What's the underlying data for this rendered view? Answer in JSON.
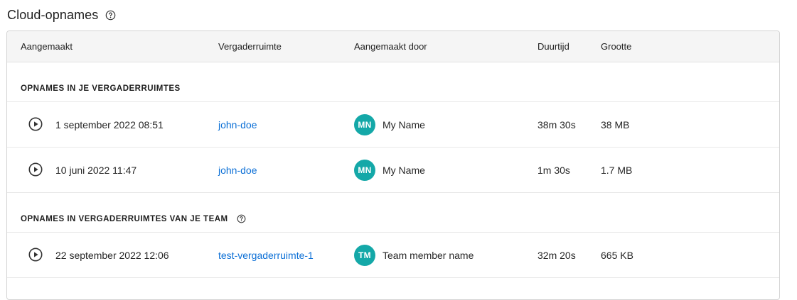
{
  "header": {
    "title": "Cloud-opnames",
    "help_icon": "question-circle-icon"
  },
  "columns": {
    "created": "Aangemaakt",
    "room": "Vergaderruimte",
    "created_by": "Aangemaakt door",
    "duration": "Duurtijd",
    "size": "Grootte"
  },
  "sections": [
    {
      "label": "OPNAMES IN JE VERGADERRUIMTES",
      "rows": [
        {
          "date": "1 september 2022 08:51",
          "room": "john-doe",
          "initials": "MN",
          "name": "My Name",
          "duration": "38m 30s",
          "size": "38 MB"
        },
        {
          "date": "10 juni 2022 11:47",
          "room": "john-doe",
          "initials": "MN",
          "name": "My Name",
          "duration": "1m 30s",
          "size": "1.7 MB"
        }
      ]
    },
    {
      "label": "OPNAMES IN VERGADERRUIMTES VAN JE TEAM",
      "rows": [
        {
          "date": "22 september 2022 12:06",
          "room": "test-vergaderruimte-1",
          "initials": "TM",
          "name": "Team member name",
          "duration": "32m 20s",
          "size": "665 KB"
        }
      ]
    }
  ],
  "colors": {
    "accent_link": "#0b6fd6",
    "avatar": "#14a8a8"
  }
}
